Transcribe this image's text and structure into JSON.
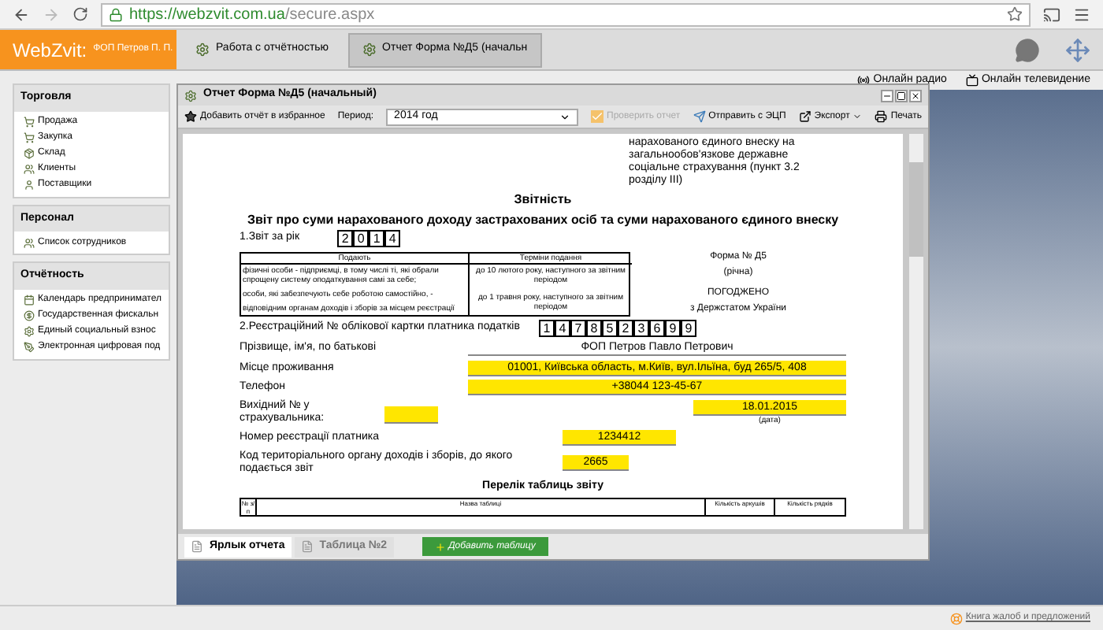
{
  "browser": {
    "url_host": "https://webzvit.com.ua",
    "url_path": "/secure.aspx"
  },
  "app_header": {
    "logo": "WebZvit:",
    "account": "ФОП Петров П. П.",
    "tabs": [
      {
        "label": "Работа с отчётностью",
        "selected": false
      },
      {
        "label": "Отчет Форма №Д5 (начальн",
        "selected": true
      }
    ]
  },
  "top_links": [
    "Онлайн радио",
    "Онлайн телевидение"
  ],
  "sidebar": [
    {
      "title": "Торговля",
      "items": [
        {
          "label": "Продажа",
          "kind": "cart"
        },
        {
          "label": "Закупка",
          "kind": "cart"
        },
        {
          "label": "Склад",
          "kind": "box"
        },
        {
          "label": "Клиенты",
          "kind": "people"
        },
        {
          "label": "Поставщики",
          "kind": "person"
        }
      ]
    },
    {
      "title": "Персонал",
      "items": [
        {
          "label": "Список сотрудников",
          "kind": "people"
        }
      ]
    },
    {
      "title": "Отчётность",
      "items": [
        {
          "label": "Календарь предпринимател",
          "kind": "calendar"
        },
        {
          "label": "Государственная фискальн",
          "kind": "coin"
        },
        {
          "label": "Единый социальный взнос",
          "kind": "gear"
        },
        {
          "label": "Электронная цифровая под",
          "kind": "pen"
        }
      ]
    }
  ],
  "dialog": {
    "title": "Отчет Форма №Д5 (начальный)",
    "toolbar": {
      "favorite": "Добавить отчёт в избранное",
      "period_label": "Период:",
      "period_value": "2014 год",
      "check": {
        "label": "Проверить отчет",
        "disabled": true
      },
      "send": "Отправить с ЭЦП",
      "export": "Экспорт",
      "print": "Печать"
    },
    "document": {
      "top_note": "нарахованого єдиного внеску на загальнообов'язкове державне соціальне страхування (пункт 3.2 розділу III)",
      "heading": "Звітність",
      "title": "Звіт про суми нарахованого доходу застрахованих осіб та суми нарахованого єдиного внеску",
      "year_label": "1.Звіт за рік",
      "year_digits": [
        "2",
        "0",
        "1",
        "4"
      ],
      "terms_table": {
        "columns": [
          "Подають",
          "Терміни подання"
        ],
        "payers": [
          "фізичні особи - підприємці, в тому числі ті, які обрали спрощену систему оподаткування самі за себе;",
          "особи, які забезпечують себе роботою самостійно, -",
          "відповідним органам доходів і зборів за місцем реєстрації"
        ],
        "deadlines": [
          "до 10 лютого року, наступного за звітним періодом",
          "до 1 травня року, наступного за звітним періодом"
        ]
      },
      "form_name": "Форма № Д5",
      "form_period": "(річна)",
      "approved": "ПОГОДЖЕНО",
      "approved_by": "з Держстатом України",
      "reg_label": "2.Реєстраційний № облікової картки платника податків",
      "reg_digits": [
        "1",
        "4",
        "7",
        "8",
        "5",
        "2",
        "3",
        "6",
        "9",
        "9"
      ],
      "fields": [
        {
          "kind": "plain",
          "label": "Прізвище, ім'я, по батькові",
          "value": "ФОП Петров Павло Петрович"
        },
        {
          "kind": "yellow",
          "label": "Місце проживання",
          "value": "01001, Київська область, м.Київ, вул.Ільїна, буд 265/5, 408"
        },
        {
          "kind": "yellow",
          "label": "Телефон",
          "value": "+38044 123-45-67"
        }
      ],
      "outgoing_label": "Вихідний № у страхувальника:",
      "outgoing_date": "18.01.2015",
      "date_caption": "(дата)",
      "payer_reg_label": "Номер реєстрації платника",
      "payer_reg_value": "1234412",
      "office_label": "Код територіального органу доходів і зборів, до якого подається звіт",
      "office_value": "2665",
      "tables_title": "Перелік таблиць звіту",
      "tables_columns": [
        "№ з/п",
        "Назва таблиці",
        "Кількість аркушів",
        "Кількість рядків"
      ]
    },
    "tabs": [
      {
        "label": "Ярлык отчета",
        "selected": true
      },
      {
        "label": "Таблица №2",
        "selected": false
      }
    ],
    "add_table": "Добавить таблицу"
  },
  "status_bar": {
    "link": "Книга жалоб и предложений"
  }
}
